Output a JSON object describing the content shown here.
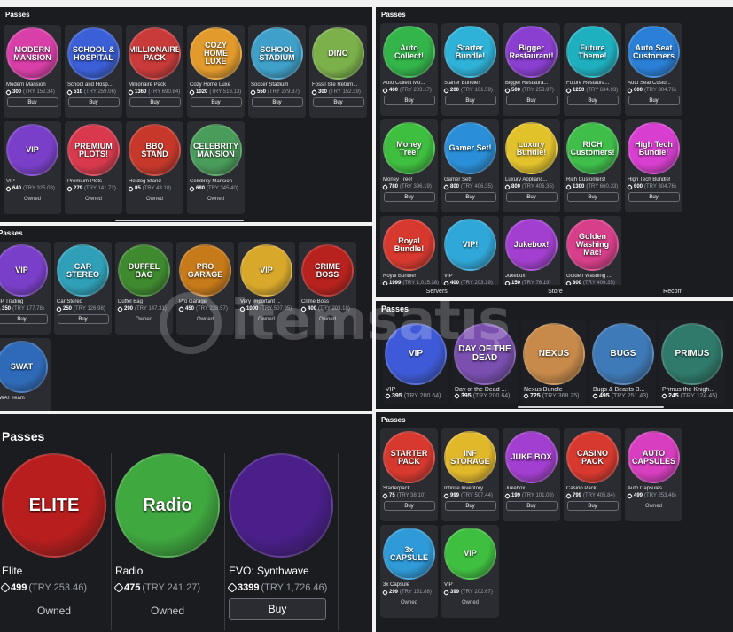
{
  "panels": {
    "p1": {
      "title": "Passes",
      "items": [
        {
          "thumb": "MODERN MANSION",
          "name": "Modern Mansion",
          "price": "300",
          "try": "(TRY 152.34)",
          "action": "Buy",
          "bg": "#d93fa8"
        },
        {
          "thumb": "SCHOOL & HOSPITAL",
          "name": "School and Hosp...",
          "price": "510",
          "try": "(TRY 259.06)",
          "action": "Buy",
          "bg": "#3b5fd6"
        },
        {
          "thumb": "MILLIONAIRE PACK",
          "name": "Millionaire Pack",
          "price": "1360",
          "try": "(TRY 690.84)",
          "action": "Buy",
          "bg": "#c93a3a"
        },
        {
          "thumb": "COZY HOME LUXE",
          "name": "Cozy Home Luxe",
          "price": "1020",
          "try": "(TRY 518.13)",
          "action": "Buy",
          "bg": "#e29a2b"
        },
        {
          "thumb": "SCHOOL STADIUM",
          "name": "Soccer Stadium",
          "price": "550",
          "try": "(TRY 279.37)",
          "action": "Buy",
          "bg": "#3fa0c9"
        },
        {
          "thumb": "DINO",
          "name": "Fossil Isle Return...",
          "price": "300",
          "try": "(TRY 152.39)",
          "action": "Buy",
          "bg": "#7bb04a"
        },
        {
          "thumb": "VIP",
          "name": "VIP",
          "price": "640",
          "try": "(TRY 325.08)",
          "action": "Owned",
          "bg": "#7a3fc9"
        },
        {
          "thumb": "PREMIUM PLOTS!",
          "name": "Premium Plots",
          "price": "279",
          "try": "(TRY 141.72)",
          "action": "Owned",
          "bg": "#d9394d"
        },
        {
          "thumb": "BBQ STAND",
          "name": "Hotdog Stand",
          "price": "85",
          "try": "(TRY 43.18)",
          "action": "Owned",
          "bg": "#c7382b"
        },
        {
          "thumb": "CELEBRITY MANSION",
          "name": "Celebrity Mansion",
          "price": "680",
          "try": "(TRY 345.40)",
          "action": "Owned",
          "bg": "#4a9c5a"
        }
      ]
    },
    "p2": {
      "title": "Passes",
      "items": [
        {
          "thumb": "Auto Collect!",
          "name": "Auto Collect Mo...",
          "price": "400",
          "try": "(TRY 203.17)",
          "action": "Buy",
          "bg": "#33b54a"
        },
        {
          "thumb": "Starter Bundle!",
          "name": "Starter Bundle!",
          "price": "200",
          "try": "(TRY 101.59)",
          "action": "Buy",
          "bg": "#2fb2d8"
        },
        {
          "thumb": "Bigger Restaurant!",
          "name": "Bigger Restaura...",
          "price": "500",
          "try": "(TRY 253.97)",
          "action": "Buy",
          "bg": "#8a3fd0"
        },
        {
          "thumb": "Future Theme!",
          "name": "Future Restaura...",
          "price": "1250",
          "try": "(TRY 634.93)",
          "action": "Buy",
          "bg": "#1fb0c0"
        },
        {
          "thumb": "Auto Seat Customers",
          "name": "Auto Seat Custo...",
          "price": "600",
          "try": "(TRY 304.76)",
          "action": "Buy",
          "bg": "#2a7fd6"
        },
        {
          "thumb": "Money Tree!",
          "name": "Money Tree!",
          "price": "780",
          "try": "(TRY 396.19)",
          "action": "Buy",
          "bg": "#3fbf3f"
        },
        {
          "thumb": "Gamer Set!",
          "name": "Gamer Set!",
          "price": "800",
          "try": "(TRY 406.35)",
          "action": "Buy",
          "bg": "#2a8fd8"
        },
        {
          "thumb": "Luxury Bundle!",
          "name": "Luxury Applianc...",
          "price": "800",
          "try": "(TRY 406.35)",
          "action": "Buy",
          "bg": "#e2c22b"
        },
        {
          "thumb": "RICH Customers!",
          "name": "Rich Customers!",
          "price": "1300",
          "try": "(TRY 660.33)",
          "action": "Buy",
          "bg": "#3fbf4a"
        },
        {
          "thumb": "High Tech Bundle!",
          "name": "High Tech Bundle!",
          "price": "600",
          "try": "(TRY 304.76)",
          "action": "Buy",
          "bg": "#d83fd0"
        },
        {
          "thumb": "Royal Bundle!",
          "name": "Royal Bundle!",
          "price": "1999",
          "try": "(TRY 1,015.38)",
          "action": "Buy",
          "bg": "#d8392f"
        },
        {
          "thumb": "VIP!",
          "name": "VIP",
          "price": "400",
          "try": "(TRY 203.19)",
          "action": "Owned",
          "bg": "#2fa7d8"
        },
        {
          "thumb": "Jukebox!",
          "name": "Jukebox!",
          "price": "150",
          "try": "(TRY 76.19)",
          "action": "Buy",
          "bg": "#a33fd0"
        },
        {
          "thumb": "Golden Washing Mac!",
          "name": "Golden Washing ...",
          "price": "800",
          "try": "(TRY 406.35)",
          "action": "Buy",
          "bg": "#d83f8a"
        }
      ],
      "nav": [
        "Servers",
        "Store",
        "Recom"
      ]
    },
    "p3": {
      "title": "Passes",
      "items": [
        {
          "thumb": "VIP",
          "name": "VIP Trading",
          "price": "350",
          "try": "(TRY 177.78)",
          "action": "Buy",
          "bg": "#7a3fc9"
        },
        {
          "thumb": "CAR STEREO",
          "name": "Car Stereo",
          "price": "250",
          "try": "(TRY 126.98)",
          "action": "Buy",
          "bg": "#2fa0b8"
        },
        {
          "thumb": "DUFFEL BAG",
          "name": "Duffel Bag",
          "price": "290",
          "try": "(TRY 147.31)",
          "action": "Owned",
          "bg": "#3f8a2f"
        },
        {
          "thumb": "PRO GARAGE",
          "name": "Pro Garage",
          "price": "450",
          "try": "(TRY 228.57)",
          "action": "Owned",
          "bg": "#c77a1a"
        },
        {
          "thumb": "VIP",
          "name": "Very Important ...",
          "price": "1000",
          "try": "(TRY 507.95)",
          "action": "Owned",
          "bg": "#d8a82b"
        },
        {
          "thumb": "CRIME BOSS",
          "name": "Crime Boss",
          "price": "400",
          "try": "(TRY 203.18)",
          "action": "Owned",
          "bg": "#b8221e"
        },
        {
          "thumb": "SWAT",
          "name": "SWAT Team",
          "price": "",
          "try": "",
          "action": "",
          "bg": "#2f6ab8"
        }
      ]
    },
    "p4": {
      "title": "Passes",
      "items": [
        {
          "thumb": "VIP",
          "name": "VIP",
          "price": "395",
          "try": "(TRY 200.64)",
          "bg": "#3f5ad8"
        },
        {
          "thumb": "DAY OF THE DEAD",
          "name": "Day of the Dead ...",
          "price": "395",
          "try": "(TRY 200.64)",
          "bg": "#7a4fb0"
        },
        {
          "thumb": "NEXUS",
          "name": "Nexus Bundle",
          "price": "725",
          "try": "(TRY 368.25)",
          "bg": "#c78a4a"
        },
        {
          "thumb": "BUGS",
          "name": "Bugs & Beasts B...",
          "price": "495",
          "try": "(TRY 251.43)",
          "bg": "#3f7ab8"
        },
        {
          "thumb": "PRIMUS",
          "name": "Primus the Knigh...",
          "price": "245",
          "try": "(TRY 124.45)",
          "bg": "#2f7a6a"
        }
      ]
    },
    "p5": {
      "title": "Passes",
      "items": [
        {
          "thumb": "STARTER PACK",
          "name": "Starterpack",
          "price": "75",
          "try": "(TRY 38.10)",
          "action": "Buy",
          "bg": "#d8392f"
        },
        {
          "thumb": "INF STORAGE",
          "name": "Infinite Inventory",
          "price": "999",
          "try": "(TRY 507.44)",
          "action": "Buy",
          "bg": "#e2b82b"
        },
        {
          "thumb": "JUKE BOX",
          "name": "Jukebox",
          "price": "199",
          "try": "(TRY 101.08)",
          "action": "Buy",
          "bg": "#a33fd0"
        },
        {
          "thumb": "CASINO PACK",
          "name": "Casino Pack",
          "price": "799",
          "try": "(TRY 405.84)",
          "action": "Buy",
          "bg": "#d8392f"
        },
        {
          "thumb": "AUTO CAPSULES",
          "name": "Auto Capsules",
          "price": "499",
          "try": "(TRY 253.46)",
          "action": "Owned",
          "bg": "#d83fc0"
        },
        {
          "thumb": "3x CAPSULE",
          "name": "3x Capsule",
          "price": "299",
          "try": "(TRY 151.88)",
          "action": "Owned",
          "bg": "#2f9ad8"
        },
        {
          "thumb": "VIP",
          "name": "VIP",
          "price": "399",
          "try": "(TRY 202.67)",
          "action": "Owned",
          "bg": "#3fbf3f"
        }
      ]
    },
    "p6": {
      "title": "Passes",
      "items": [
        {
          "thumb": "ELITE",
          "name": "Elite",
          "price": "499",
          "try": "(TRY 253.46)",
          "action": "Owned",
          "bg": "#b81e1e"
        },
        {
          "thumb": "Radio",
          "name": "Radio",
          "price": "475",
          "try": "(TRY 241.27)",
          "action": "Owned",
          "bg": "#3fa83f"
        },
        {
          "thumb": "",
          "name": "EVO: Synthwave",
          "price": "3399",
          "try": "(TRY 1,726.46)",
          "action": "Buy",
          "bg": "#4a1f8a"
        }
      ]
    }
  },
  "watermark": "itemsatış"
}
